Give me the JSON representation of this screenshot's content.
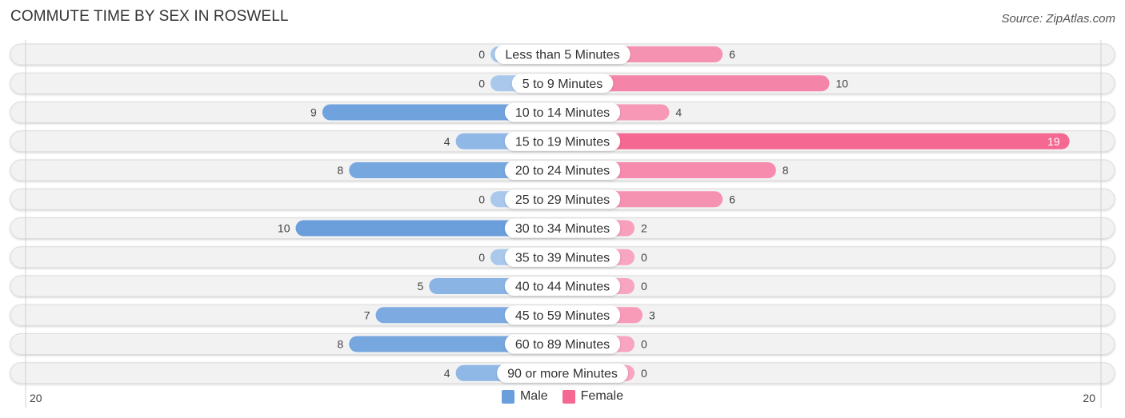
{
  "header": {
    "title": "COMMUTE TIME BY SEX IN ROSWELL",
    "source": "Source: ZipAtlas.com"
  },
  "colors": {
    "male": "#6a9fdc",
    "male_light": "#a9c8ec",
    "female": "#f46892",
    "female_light": "#f7a5c0",
    "track": "#f2f2f2"
  },
  "chart_data": {
    "type": "bar",
    "orientation": "horizontal-diverging",
    "title": "COMMUTE TIME BY SEX IN ROSWELL",
    "categories": [
      "Less than 5 Minutes",
      "5 to 9 Minutes",
      "10 to 14 Minutes",
      "15 to 19 Minutes",
      "20 to 24 Minutes",
      "25 to 29 Minutes",
      "30 to 34 Minutes",
      "35 to 39 Minutes",
      "40 to 44 Minutes",
      "45 to 59 Minutes",
      "60 to 89 Minutes",
      "90 or more Minutes"
    ],
    "series": [
      {
        "name": "Male",
        "values": [
          0,
          0,
          9,
          4,
          8,
          0,
          10,
          0,
          5,
          7,
          8,
          4
        ]
      },
      {
        "name": "Female",
        "values": [
          6,
          10,
          4,
          19,
          8,
          6,
          2,
          0,
          0,
          3,
          0,
          0
        ]
      }
    ],
    "axis": {
      "left_label": "20",
      "right_label": "20",
      "max": 20
    },
    "legend": {
      "position": "bottom-center",
      "entries": [
        "Male",
        "Female"
      ]
    },
    "grid": false
  }
}
